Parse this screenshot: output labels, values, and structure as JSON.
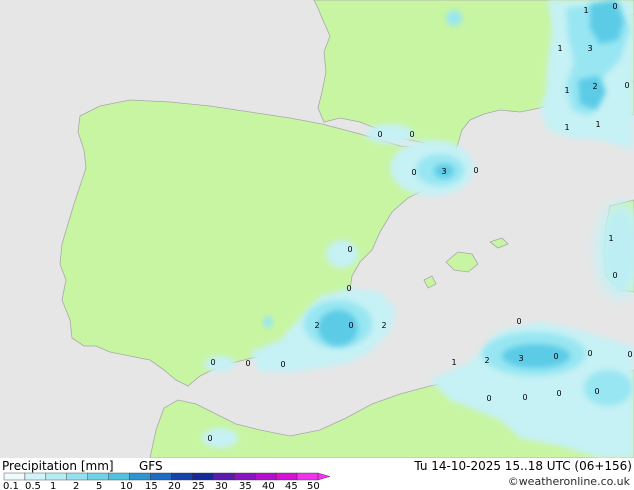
{
  "colors": {
    "sea": "#e6e6e6",
    "land": "#c8f5a2",
    "border": "#a8a8a8",
    "precip_light": "#c6f1f5",
    "precip_mid": "#98e6f2",
    "precip_heavy": "#5ccbe6",
    "precip_max": "#3eb8dc"
  },
  "map_labels": [
    "0",
    "0",
    "0",
    "3",
    "0",
    "0",
    "0",
    "2",
    "2",
    "0",
    "0",
    "0",
    "0",
    "0",
    "0",
    "1",
    "2",
    "3",
    "0",
    "0",
    "0",
    "0",
    "0",
    "0",
    "0",
    "1",
    "3",
    "1",
    "1",
    "2",
    "0",
    "1",
    "1",
    "1",
    "0",
    "0"
  ],
  "footer": {
    "title": "Precipitation [mm]",
    "model": "GFS",
    "valid_time": "Tu 14-10-2025 15..18 UTC (06+156)",
    "credit": "©weatheronline.co.uk"
  },
  "legend": {
    "ticks": [
      "0.1",
      "0.5",
      "1",
      "2",
      "5",
      "10",
      "15",
      "20",
      "25",
      "30",
      "35",
      "40",
      "45",
      "50"
    ],
    "colors": [
      "#eefbfd",
      "#d2f4f9",
      "#b5ecf4",
      "#93e1ee",
      "#6fd3e7",
      "#4fc2df",
      "#2c95d2",
      "#1e6cc3",
      "#1642ae",
      "#142a9a",
      "#5a1cb0",
      "#8a14c2",
      "#b30fcf",
      "#d610d8",
      "#ee33ee"
    ]
  }
}
